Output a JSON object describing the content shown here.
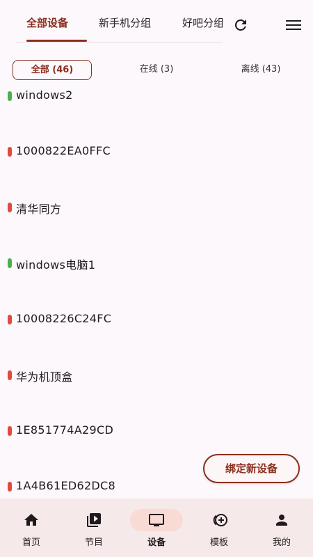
{
  "group_tabs": [
    {
      "label": "全部设备",
      "active": true
    },
    {
      "label": "新手机分组",
      "active": false
    },
    {
      "label": "好吧分组",
      "active": false
    }
  ],
  "icons": {
    "refresh": "refresh-icon",
    "menu": "menu-icon"
  },
  "filters": [
    {
      "label": "全部 (46)",
      "active": true
    },
    {
      "label": "在线 (3)",
      "active": false
    },
    {
      "label": "离线 (43)",
      "active": false
    }
  ],
  "devices": [
    {
      "name": "windows2",
      "status": "online"
    },
    {
      "name": "1000822EA0FFC",
      "status": "offline"
    },
    {
      "name": "清华同方",
      "status": "offline"
    },
    {
      "name": "windows电脑1",
      "status": "online"
    },
    {
      "name": "10008226C24FC",
      "status": "offline"
    },
    {
      "name": "华为机顶盒",
      "status": "offline"
    },
    {
      "name": "1E851774A29CD",
      "status": "offline"
    },
    {
      "name": "1A4B61ED62DC8",
      "status": "offline"
    }
  ],
  "bind_button_label": "绑定新设备",
  "nav": [
    {
      "label": "首页",
      "icon": "home-icon",
      "active": false
    },
    {
      "label": "节目",
      "icon": "video-library-icon",
      "active": false
    },
    {
      "label": "设备",
      "icon": "monitor-icon",
      "active": true
    },
    {
      "label": "模板",
      "icon": "add-circle-stack-icon",
      "active": false
    },
    {
      "label": "我的",
      "icon": "person-icon",
      "active": false
    }
  ],
  "colors": {
    "accent": "#8b2e1e",
    "online": "#4caf50",
    "offline": "#e04b3f",
    "nav_background": "#f6e9e9",
    "nav_active_pill": "#fadad5"
  }
}
